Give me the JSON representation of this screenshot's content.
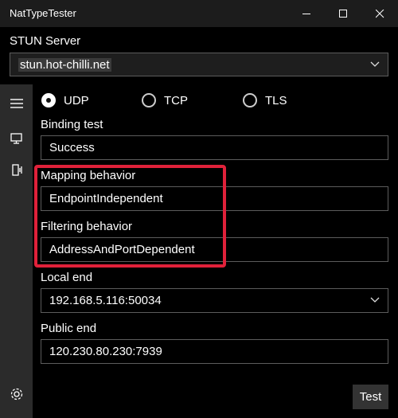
{
  "window": {
    "title": "NatTypeTester"
  },
  "stun": {
    "label": "STUN Server",
    "value": "stun.hot-chilli.net"
  },
  "protocol": {
    "options": [
      "UDP",
      "TCP",
      "TLS"
    ],
    "selected": "UDP"
  },
  "fields": {
    "binding_label": "Binding test",
    "binding_value": "Success",
    "mapping_label": "Mapping behavior",
    "mapping_value": "EndpointIndependent",
    "filtering_label": "Filtering behavior",
    "filtering_value": "AddressAndPortDependent",
    "local_label": "Local end",
    "local_value": "192.168.5.116:50034",
    "public_label": "Public end",
    "public_value": "120.230.80.230:7939"
  },
  "actions": {
    "test_label": "Test"
  },
  "colors": {
    "highlight": "#e0213a",
    "sidebar": "#2b2b2b",
    "titlebar": "#1c1c1c"
  },
  "icons": [
    "minimize-icon",
    "maximize-icon",
    "close-icon",
    "hamburger-menu-icon",
    "monitor-icon",
    "device-icon",
    "gear-icon",
    "chevron-down-icon"
  ]
}
